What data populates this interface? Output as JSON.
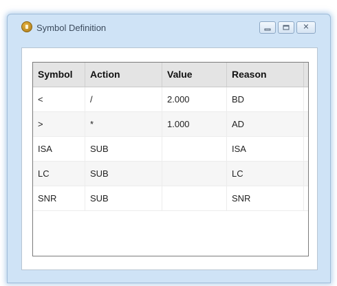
{
  "window": {
    "title": "Symbol Definition",
    "icon": "app-info-icon",
    "buttons": {
      "minimize": "minimize-icon",
      "maximize": "maximize-icon",
      "close": "✕"
    }
  },
  "table": {
    "columns": [
      "Symbol",
      "Action",
      "Value",
      "Reason"
    ],
    "rows": [
      [
        "<",
        "/",
        "2.000",
        "BD"
      ],
      [
        ">",
        "*",
        "1.000",
        "AD"
      ],
      [
        "ISA",
        "SUB",
        "",
        "ISA"
      ],
      [
        "LC",
        "SUB",
        "",
        "LC"
      ],
      [
        "SNR",
        "SUB",
        "",
        "SNR"
      ]
    ]
  }
}
